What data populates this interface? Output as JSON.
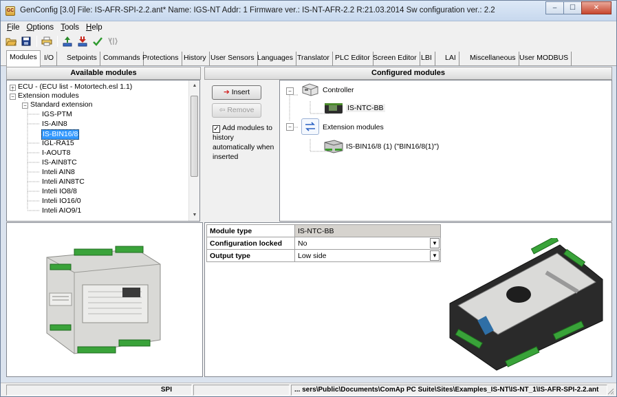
{
  "window": {
    "title": "GenConfig [3.0]  File: IS-AFR-SPI-2.2.ant*  Name: IGS-NT  Addr: 1  Firmware ver.: IS-NT-AFR-2.2 R:21.03.2014  Sw configuration ver.: 2.2",
    "icon_text": "GC",
    "minimize": "–",
    "maximize": "☐",
    "close": "✕"
  },
  "menu": [
    {
      "u": "F",
      "rest": "ile"
    },
    {
      "u": "O",
      "rest": "ptions"
    },
    {
      "u": "T",
      "rest": "ools"
    },
    {
      "u": "H",
      "rest": "elp"
    }
  ],
  "tabs": [
    "Modules",
    "I/O",
    "Setpoints",
    "Commands",
    "Protections",
    "History",
    "User Sensors",
    "Languages",
    "Translator",
    "PLC Editor",
    "Screen Editor",
    "LBI",
    "LAI",
    "Miscellaneous",
    "User MODBUS"
  ],
  "available": {
    "header": "Available modules",
    "tree": [
      "ECU - (ECU list - Motortech.esl 1.1)",
      "Extension modules",
      "Standard extension",
      "IGS-PTM",
      "IS-AIN8",
      "IS-BIN16/8",
      "IGL-RA15",
      "I-AOUT8",
      "IS-AIN8TC",
      "Inteli AIN8",
      "Inteli AIN8TC",
      "Inteli IO8/8",
      "Inteli IO16/0",
      "Inteli AIO9/1"
    ]
  },
  "actions": {
    "insert": "Insert",
    "remove": "Remove",
    "history_checkbox": "Add modules to history automatically when inserted",
    "history_checked": true
  },
  "configured": {
    "header": "Configured modules",
    "controller": "Controller",
    "controller_module": "IS-NTC-BB",
    "extension": "Extension modules",
    "extension_module": "IS-BIN16/8 (1) (\"BIN16/8(1)\")"
  },
  "properties": [
    {
      "key": "Module type",
      "value": "IS-NTC-BB",
      "dropdown": false
    },
    {
      "key": "Configuration locked",
      "value": "No",
      "dropdown": true
    },
    {
      "key": "Output type",
      "value": "Low side",
      "dropdown": true
    }
  ],
  "status": {
    "mode": "SPI",
    "path": "... sers\\Public\\Documents\\ComAp PC Suite\\Sites\\Examples_IS-NT\\IS-NT_1\\IS-AFR-SPI-2.2.ant"
  }
}
